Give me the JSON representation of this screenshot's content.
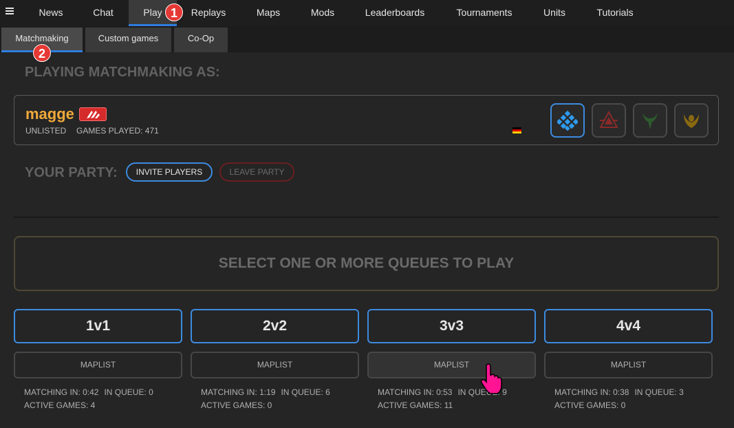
{
  "topnav": {
    "items": [
      {
        "label": "News"
      },
      {
        "label": "Chat"
      },
      {
        "label": "Play",
        "active": true
      },
      {
        "label": "Replays"
      },
      {
        "label": "Maps"
      },
      {
        "label": "Mods"
      },
      {
        "label": "Leaderboards"
      },
      {
        "label": "Tournaments"
      },
      {
        "label": "Units"
      },
      {
        "label": "Tutorials"
      }
    ]
  },
  "subnav": {
    "items": [
      {
        "label": "Matchmaking",
        "active": true
      },
      {
        "label": "Custom games"
      },
      {
        "label": "Co-Op"
      }
    ]
  },
  "markers": [
    "1",
    "2"
  ],
  "player_section": {
    "title": "PLAYING MATCHMAKING AS:",
    "name": "magge",
    "rank": "UNLISTED",
    "games_played": "GAMES PLAYED: 471",
    "flag_colors": [
      "#000000",
      "#dd0000",
      "#ffce00"
    ],
    "races": [
      {
        "icon": "random-race-icon",
        "selected": true,
        "color": "#2e9bf0"
      },
      {
        "icon": "terran-race-icon",
        "selected": false,
        "color": "#8a2a2a"
      },
      {
        "icon": "zerg-race-icon",
        "selected": false,
        "color": "#2e5a2e"
      },
      {
        "icon": "protoss-race-icon",
        "selected": false,
        "color": "#8a6a10"
      }
    ]
  },
  "party": {
    "title": "YOUR PARTY:",
    "invite_label": "INVITE PLAYERS",
    "leave_label": "LEAVE PARTY"
  },
  "queue_banner": "SELECT ONE OR MORE QUEUES TO PLAY",
  "queues": [
    {
      "mode": "1v1",
      "maplist": "MAPLIST",
      "matching": "MATCHING IN: 0:42",
      "in_queue": "IN QUEUE: 0",
      "active": "ACTIVE GAMES: 4"
    },
    {
      "mode": "2v2",
      "maplist": "MAPLIST",
      "matching": "MATCHING IN: 1:19",
      "in_queue": "IN QUEUE: 6",
      "active": "ACTIVE GAMES: 0"
    },
    {
      "mode": "3v3",
      "maplist": "MAPLIST",
      "matching": "MATCHING IN: 0:53",
      "in_queue": "IN QUEUE: 9",
      "active": "ACTIVE GAMES: 11"
    },
    {
      "mode": "4v4",
      "maplist": "MAPLIST",
      "matching": "MATCHING IN: 0:38",
      "in_queue": "IN QUEUE: 3",
      "active": "ACTIVE GAMES: 0"
    }
  ],
  "colors": {
    "accent": "#2e7de0",
    "player_name": "#f0a93a",
    "cursor": "#ff1493"
  }
}
